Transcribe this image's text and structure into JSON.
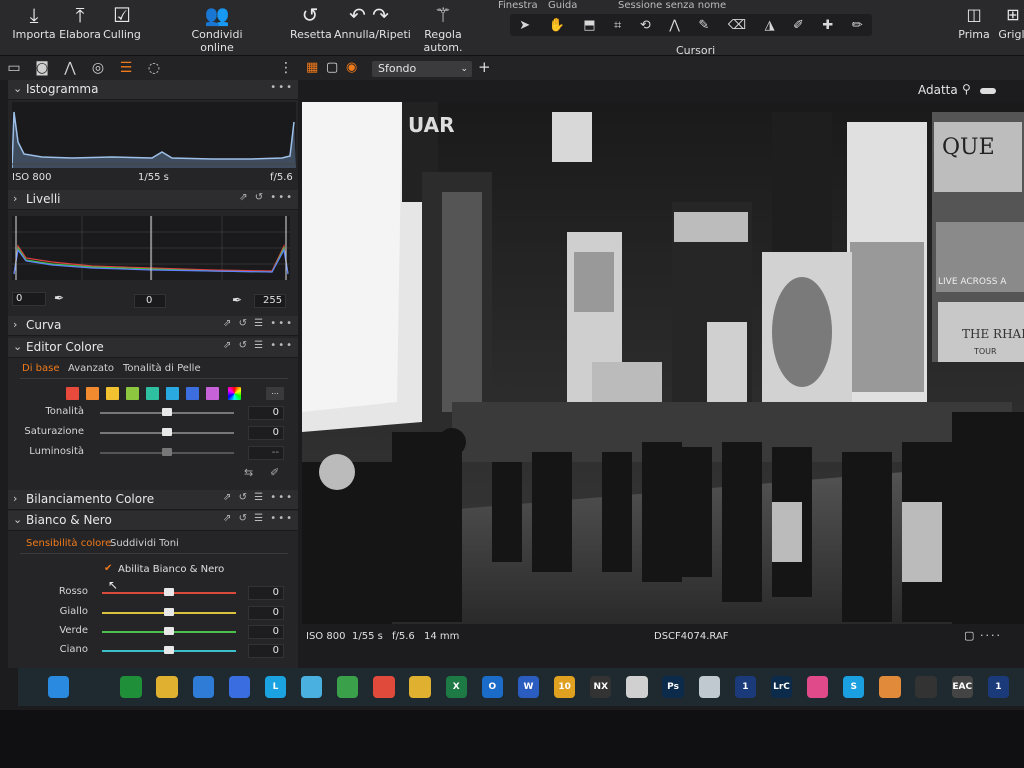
{
  "toolbar": {
    "importa": "Importa",
    "elabora": "Elabora",
    "culling": "Culling",
    "condividi": "Condividi online",
    "resetta": "Resetta",
    "annulla": "Annulla/Ripeti",
    "regola": "Regola autom.",
    "cursori": "Cursori",
    "prima": "Prima",
    "griglia": "Grigli",
    "top_cut_1": "Finestra",
    "top_cut_2": "Guida",
    "session": "Sessione senza nome"
  },
  "viewer": {
    "fit": "Adatta",
    "background_select": "Sfondo"
  },
  "histogram": {
    "title": "Istogramma",
    "iso": "ISO 800",
    "shutter": "1/55 s",
    "aperture": "f/5.6"
  },
  "levels": {
    "title": "Livelli",
    "low": "0",
    "mid": "0",
    "high": "255"
  },
  "curve": {
    "title": "Curva"
  },
  "color_editor": {
    "title": "Editor Colore",
    "tabs": [
      "Di base",
      "Avanzato",
      "Tonalità di Pelle"
    ],
    "swatches": [
      "#e84a3c",
      "#f28a30",
      "#f2c230",
      "#8dc63f",
      "#2ec0a0",
      "#2aa8e0",
      "#3c6ee0",
      "#c862d8",
      "#e0509a"
    ],
    "sliders": [
      {
        "label": "Tonalità",
        "value": "0"
      },
      {
        "label": "Saturazione",
        "value": "0"
      },
      {
        "label": "Luminosità",
        "value": "--"
      }
    ],
    "more_button": "..."
  },
  "white_balance": {
    "title": "Bilanciamento Colore"
  },
  "bw": {
    "title": "Bianco & Nero",
    "tabs": [
      "Sensibilità colore",
      "Suddividi Toni"
    ],
    "enable_label": "Abilita Bianco & Nero",
    "sliders": [
      {
        "label": "Rosso",
        "value": "0",
        "color": "#d94a3c"
      },
      {
        "label": "Giallo",
        "value": "0",
        "color": "#d9c23c"
      },
      {
        "label": "Verde",
        "value": "0",
        "color": "#4cbf4c"
      },
      {
        "label": "Ciano",
        "value": "0",
        "color": "#3cc0c8"
      }
    ]
  },
  "image_info": {
    "iso": "ISO 800",
    "shutter": "1/55 s",
    "aperture": "f/5.6",
    "focal": "14 mm",
    "filename": "DSCF4074.RAF"
  },
  "photo": {
    "sign_1": "UAR",
    "sign_2": "QUE",
    "sign_3": "LIVE ACROSS A",
    "sign_4": "THE RHAPSO",
    "sign_5": "TOUR"
  },
  "taskbar": [
    {
      "name": "start",
      "label": "",
      "color": "#2a8ae0"
    },
    {
      "name": "search",
      "label": "",
      "color": "#1e2a30"
    },
    {
      "name": "xbox",
      "label": "",
      "color": "#1f8f3a"
    },
    {
      "name": "explorer",
      "label": "",
      "color": "#e0b030"
    },
    {
      "name": "mail",
      "label": "",
      "color": "#2e7cd6"
    },
    {
      "name": "store",
      "label": "",
      "color": "#3a6ee0"
    },
    {
      "name": "l-app",
      "label": "L",
      "color": "#1aa3e0"
    },
    {
      "name": "photos",
      "label": "",
      "color": "#4ab0e0"
    },
    {
      "name": "green-app",
      "label": "",
      "color": "#3aa04a"
    },
    {
      "name": "red-app",
      "label": "",
      "color": "#e04a3a"
    },
    {
      "name": "chrome",
      "label": "",
      "color": "#e0b030"
    },
    {
      "name": "excel",
      "label": "X",
      "color": "#1d7a45"
    },
    {
      "name": "outlook",
      "label": "O",
      "color": "#1a6cc8"
    },
    {
      "name": "word",
      "label": "W",
      "color": "#2b5cc0"
    },
    {
      "name": "ten-app",
      "label": "10",
      "color": "#e0a020"
    },
    {
      "name": "nx-app",
      "label": "NX",
      "color": "#333333"
    },
    {
      "name": "fox-app",
      "label": "",
      "color": "#d0d0d0"
    },
    {
      "name": "photoshop",
      "label": "Ps",
      "color": "#0c2a4a"
    },
    {
      "name": "image-app",
      "label": "",
      "color": "#c0c8d0"
    },
    {
      "name": "capture-app",
      "label": "1",
      "color": "#1a3a7a"
    },
    {
      "name": "lightroom",
      "label": "LrC",
      "color": "#0c2a4a"
    },
    {
      "name": "photo-app",
      "label": "",
      "color": "#e04a8a"
    },
    {
      "name": "skype",
      "label": "S",
      "color": "#1aa0e0"
    },
    {
      "name": "app-circle",
      "label": "",
      "color": "#e08a3a"
    },
    {
      "name": "clapper",
      "label": "",
      "color": "#333333"
    },
    {
      "name": "eac",
      "label": "EAC",
      "color": "#444444"
    },
    {
      "name": "capture-one",
      "label": "1",
      "color": "#1a3a7a"
    }
  ]
}
